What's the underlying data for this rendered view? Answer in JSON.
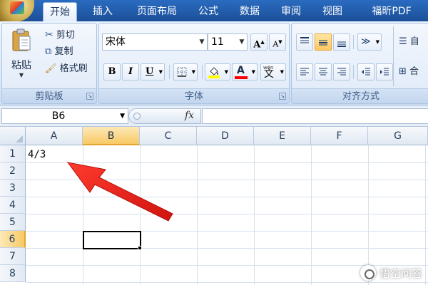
{
  "tabs": [
    {
      "label": "开始",
      "active": true
    },
    {
      "label": "插入"
    },
    {
      "label": "页面布局"
    },
    {
      "label": "公式"
    },
    {
      "label": "数据"
    },
    {
      "label": "审阅"
    },
    {
      "label": "视图"
    },
    {
      "label": "福昕PDF"
    }
  ],
  "ribbon": {
    "clipboard": {
      "paste_label": "粘贴",
      "cut_label": "剪切",
      "copy_label": "复制",
      "format_painter_label": "格式刷",
      "group_label": "剪贴板"
    },
    "font": {
      "font_name": "宋体",
      "font_size": "11",
      "grow_label": "A",
      "shrink_label": "A",
      "bold_label": "B",
      "italic_label": "I",
      "underline_label": "U",
      "font_color_label": "A",
      "phonetic_label": "文",
      "phonetic_top": "wén",
      "group_label": "字体"
    },
    "alignment": {
      "wrap_label": "自",
      "merge_label": "合",
      "group_label": "对齐方式"
    }
  },
  "formula_bar": {
    "name_box": "B6",
    "fx_label": "fx",
    "formula": ""
  },
  "grid": {
    "columns": [
      "A",
      "B",
      "C",
      "D",
      "E",
      "F",
      "G"
    ],
    "rows": [
      "1",
      "2",
      "3",
      "4",
      "5",
      "6",
      "7",
      "8"
    ],
    "selected_column": "B",
    "selected_row": "6",
    "cells": {
      "A1": "4/3"
    }
  },
  "annotation": {
    "arrow_color": "#e8231d"
  },
  "watermark": {
    "text": "悟空问答"
  },
  "colors": {
    "tab_bar": "#1e5aa8",
    "header_selected": "#f8c965",
    "highlight_yellow": "#ffff00",
    "font_color_red": "#ff0000"
  }
}
